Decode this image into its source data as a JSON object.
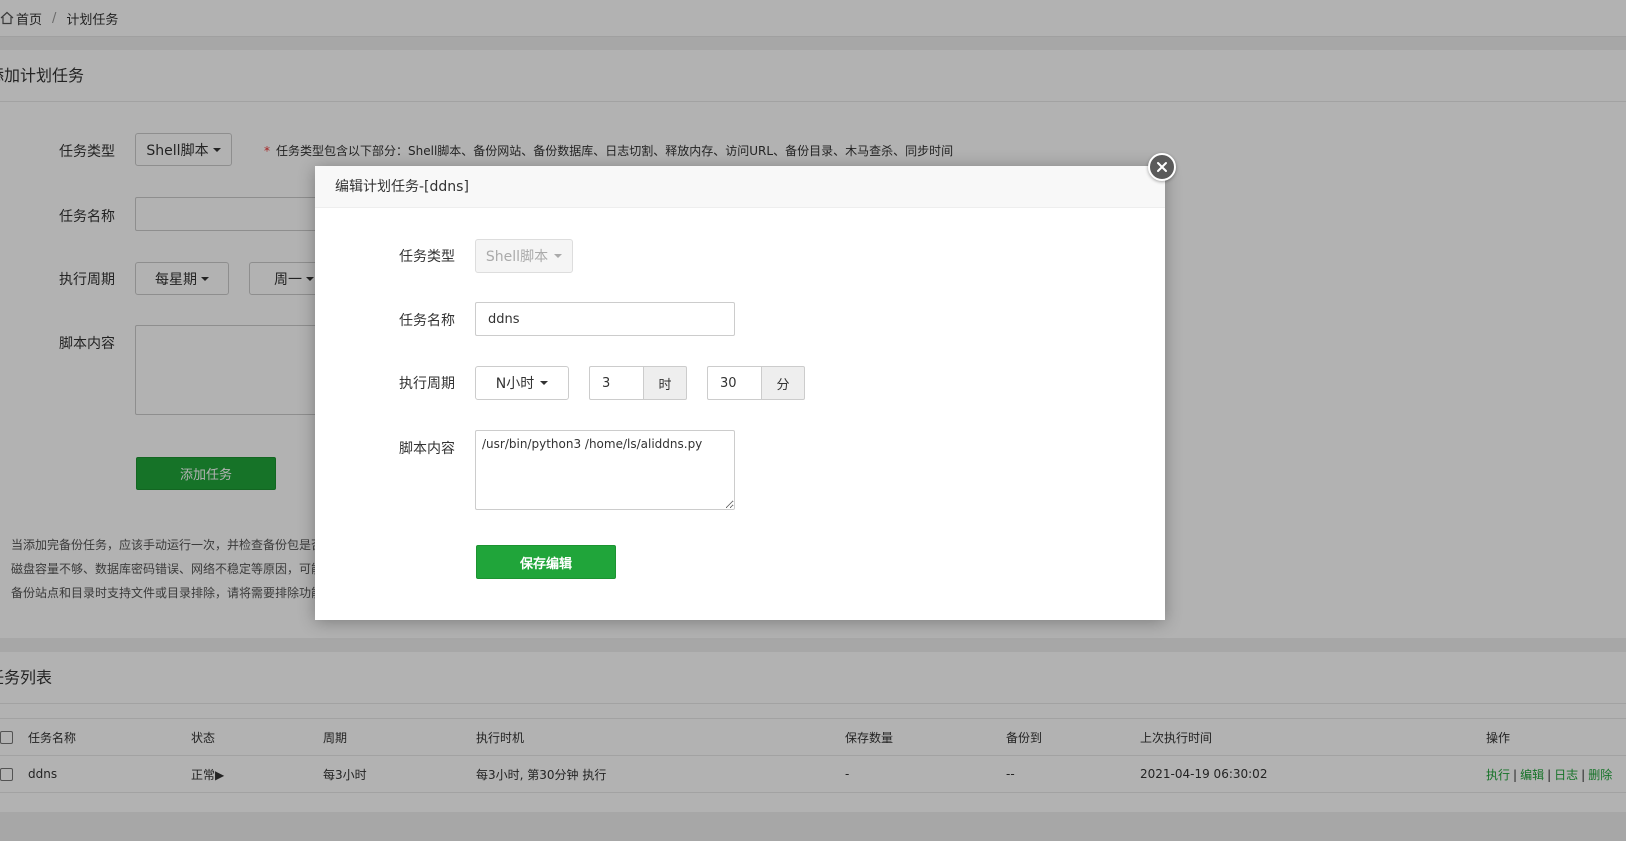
{
  "breadcrumb": {
    "home": "首页",
    "separator": "/",
    "current": "计划任务"
  },
  "add_section": {
    "title": "添加计划任务",
    "labels": {
      "type": "任务类型",
      "name": "任务名称",
      "cycle": "执行周期",
      "script": "脚本内容"
    },
    "type_value": "Shell脚本",
    "type_hint_star": "*",
    "type_hint": "任务类型包含以下部分：Shell脚本、备份网站、备份数据库、日志切割、释放内存、访问URL、备份目录、木马查杀、同步时间",
    "cycle_value": "每星期",
    "weekday_value": "周一",
    "add_button": "添加任务",
    "tips": [
      "当添加完备份任务，应该手动运行一次，并检查备份包是否",
      "磁盘容量不够、数据库密码错误、网络不稳定等原因，可能",
      "备份站点和目录时支持文件或目录排除，请将需要排除功能"
    ]
  },
  "list_section": {
    "title": "任务列表",
    "columns": [
      "任务名称",
      "状态",
      "周期",
      "执行时机",
      "保存数量",
      "备份到",
      "上次执行时间",
      "操作"
    ],
    "rows": [
      {
        "name": "ddns",
        "status": "正常▶",
        "cycle": "每3小时",
        "timing": "每3小时, 第30分钟 执行",
        "keep": "-",
        "backup_to": "--",
        "last_run": "2021-04-19 06:30:02",
        "ops": [
          "执行",
          "编辑",
          "日志",
          "删除"
        ]
      }
    ]
  },
  "modal": {
    "title": "编辑计划任务-[ddns]",
    "labels": {
      "type": "任务类型",
      "name": "任务名称",
      "cycle": "执行周期",
      "script": "脚本内容"
    },
    "type_value": "Shell脚本",
    "name_value": "ddns",
    "cycle_value": "N小时",
    "hour_value": "3",
    "hour_unit": "时",
    "minute_value": "30",
    "minute_unit": "分",
    "script_value": "/usr/bin/python3 /home/ls/aliddns.py",
    "save_button": "保存编辑"
  },
  "colors": {
    "accent_green": "#20a53a",
    "required_star": "#ee3333"
  }
}
